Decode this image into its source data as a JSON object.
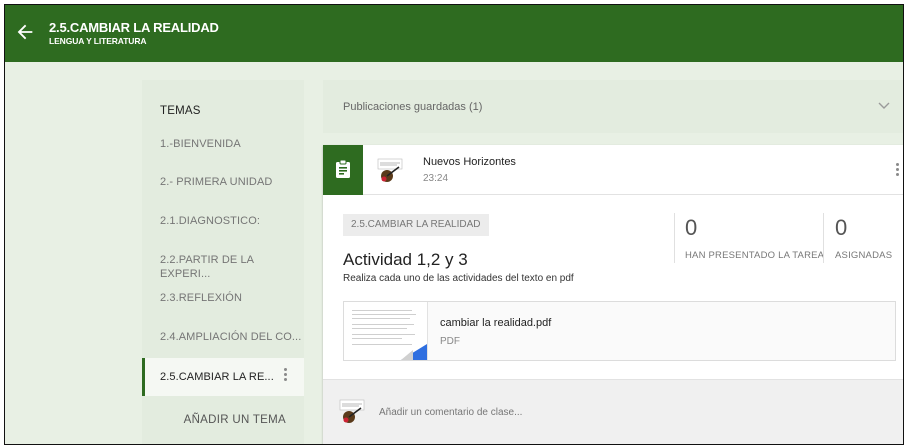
{
  "header": {
    "title": "2.5.CAMBIAR LA REALIDAD",
    "subtitle": "LENGUA Y LITERATURA",
    "color": "#2e6b20"
  },
  "sidebar": {
    "heading": "TEMAS",
    "items": [
      {
        "label": "1.-BIENVENIDA"
      },
      {
        "label": "2.- PRIMERA UNIDAD"
      },
      {
        "label": "2.1.DIAGNOSTICO:"
      },
      {
        "label": "2.2.PARTIR DE LA EXPERI..."
      },
      {
        "label": "2.3.REFLEXIÓN"
      },
      {
        "label": "2.4.AMPLIACIÓN DEL CO..."
      },
      {
        "label": "2.5.CAMBIAR LA RE...",
        "active": true
      }
    ],
    "add_label": "AÑADIR UN TEMA"
  },
  "saved": {
    "label": "Publicaciones guardadas (1)"
  },
  "post": {
    "author": "Nuevos Horizontes",
    "time": "23:24",
    "topic": "2.5.CAMBIAR LA REALIDAD",
    "title": "Actividad 1,2 y 3",
    "description": "Realiza cada uno de las actividades del texto en pdf",
    "stats": {
      "submitted_count": "0",
      "submitted_label": "HAN PRESENTADO LA TAREA",
      "assigned_count": "0",
      "assigned_label": "ASIGNADAS"
    },
    "attachment": {
      "name": "cambiar la realidad.pdf",
      "type": "PDF"
    },
    "comment_placeholder": "Añadir un comentario de clase..."
  },
  "icons": {
    "back": "arrow-left-icon",
    "expand": "chevron-down-icon",
    "assignment": "clipboard-icon",
    "more": "more-vert-icon"
  }
}
